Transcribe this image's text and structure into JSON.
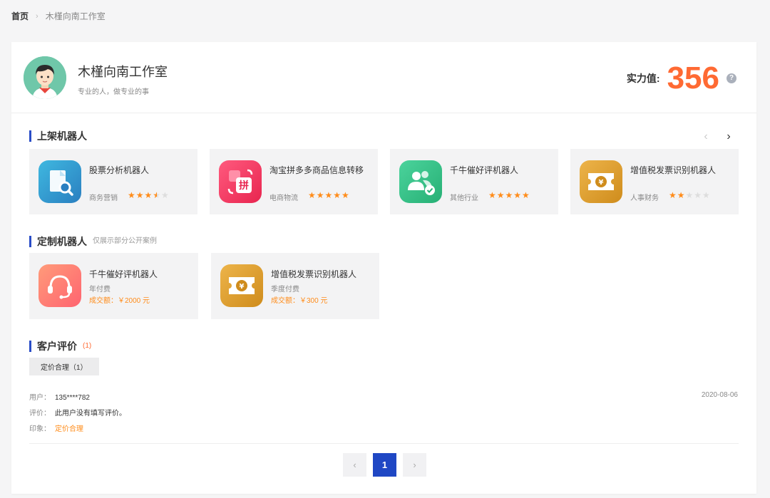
{
  "breadcrumb": {
    "home": "首页",
    "separator": "›",
    "current": "木槿向南工作室"
  },
  "profile": {
    "name": "木槿向南工作室",
    "description": "专业的人，做专业的事",
    "score_label": "实力值:",
    "score_value": "356",
    "help_icon": "?"
  },
  "listed": {
    "title": "上架机器人",
    "prev_arrow": "‹",
    "next_arrow": "›",
    "items": [
      {
        "name": "股票分析机器人",
        "category": "商务营销",
        "rating": 3.5,
        "icon": "stock-analysis-icon",
        "color": "#3aa2d4"
      },
      {
        "name": "淘宝拼多多商品信息转移",
        "category": "电商物流",
        "rating": 5,
        "icon": "pinduoduo-transfer-icon",
        "color": "#f4416b"
      },
      {
        "name": "千牛催好评机器人",
        "category": "其他行业",
        "rating": 5,
        "icon": "users-check-icon",
        "color": "#37c78b"
      },
      {
        "name": "增值税发票识别机器人",
        "category": "人事财务",
        "rating": 2,
        "icon": "invoice-ticket-icon",
        "color": "#e0a030"
      }
    ]
  },
  "custom": {
    "title": "定制机器人",
    "subtitle": "仅展示部分公开案例",
    "items": [
      {
        "name": "千牛催好评机器人",
        "billing": "年付费",
        "amount": "成交额：￥2000 元",
        "icon": "headset-icon",
        "color": "#ff7a6e"
      },
      {
        "name": "增值税发票识别机器人",
        "billing": "季度付费",
        "amount": "成交额：￥300 元",
        "icon": "invoice-ticket-icon",
        "color": "#e0a030"
      }
    ]
  },
  "reviews": {
    "title": "客户评价",
    "count": "(1)",
    "tag": "定价合理（1）",
    "user_label": "用户：",
    "user_value": "135****782",
    "comment_label": "评价：",
    "comment_value": "此用户没有填写评价。",
    "impression_label": "印象：",
    "impression_value": "定价合理",
    "date": "2020-08-06"
  },
  "pagination": {
    "prev": "‹",
    "current": "1",
    "next": "›"
  },
  "colors": {
    "accent": "#2a4dc7",
    "score": "#ff6a33",
    "star": "#ff8c1a"
  }
}
